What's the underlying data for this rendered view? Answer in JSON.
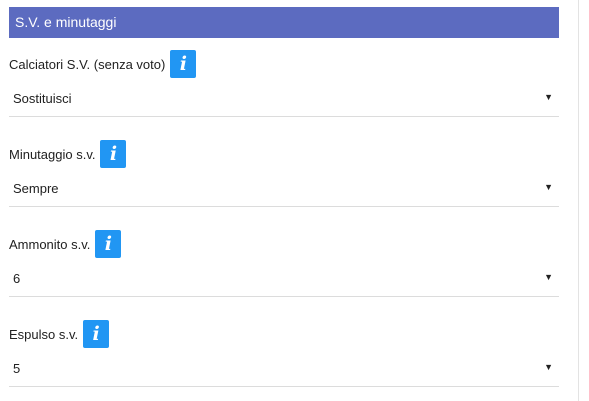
{
  "section": {
    "title": "S.V. e minutaggi"
  },
  "fields": [
    {
      "label": "Calciatori S.V. (senza voto)",
      "info_icon": "info-icon",
      "info_glyph": "i",
      "value": "Sostituisci"
    },
    {
      "label": "Minutaggio s.v.",
      "info_icon": "info-icon",
      "info_glyph": "i",
      "value": "Sempre"
    },
    {
      "label": "Ammonito s.v.",
      "info_icon": "info-icon",
      "info_glyph": "i",
      "value": "6"
    },
    {
      "label": "Espulso s.v.",
      "info_icon": "info-icon",
      "info_glyph": "i",
      "value": "5"
    }
  ],
  "select_arrow": "▼",
  "colors": {
    "header_bg": "#5c6bc0",
    "info_button_bg": "#2196f3"
  }
}
